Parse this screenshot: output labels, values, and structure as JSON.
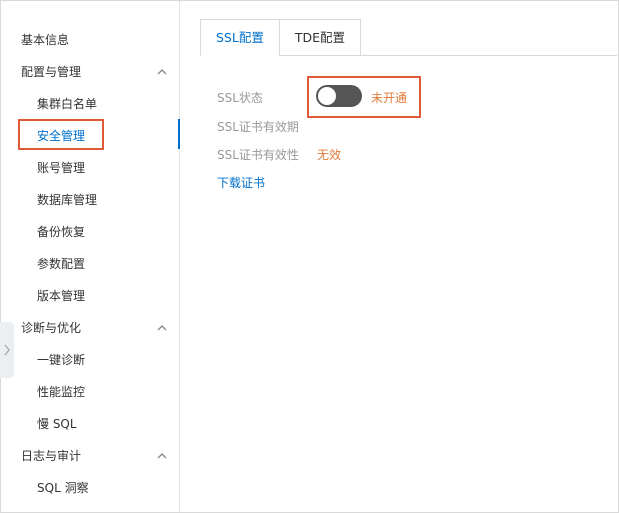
{
  "sidebar": {
    "items": [
      {
        "label": "基本信息"
      },
      {
        "label": "配置与管理"
      },
      {
        "label": "集群白名单"
      },
      {
        "label": "安全管理"
      },
      {
        "label": "账号管理"
      },
      {
        "label": "数据库管理"
      },
      {
        "label": "备份恢复"
      },
      {
        "label": "参数配置"
      },
      {
        "label": "版本管理"
      },
      {
        "label": "诊断与优化"
      },
      {
        "label": "一键诊断"
      },
      {
        "label": "性能监控"
      },
      {
        "label": "慢 SQL"
      },
      {
        "label": "日志与审计"
      },
      {
        "label": "SQL 洞察"
      }
    ],
    "active_item": "安全管理"
  },
  "tabs": [
    {
      "label": "SSL配置",
      "active": true
    },
    {
      "label": "TDE配置",
      "active": false
    }
  ],
  "ssl": {
    "status_label": "SSL状态",
    "status_value": "未开通",
    "status_enabled": false,
    "cert_expiry_label": "SSL证书有效期",
    "cert_validity_label": "SSL证书有效性",
    "cert_validity_value": "无效",
    "download_label": "下载证书"
  },
  "colors": {
    "accent": "#0070cc",
    "highlight": "#e05a3a",
    "warning_text": "#e07b39"
  }
}
